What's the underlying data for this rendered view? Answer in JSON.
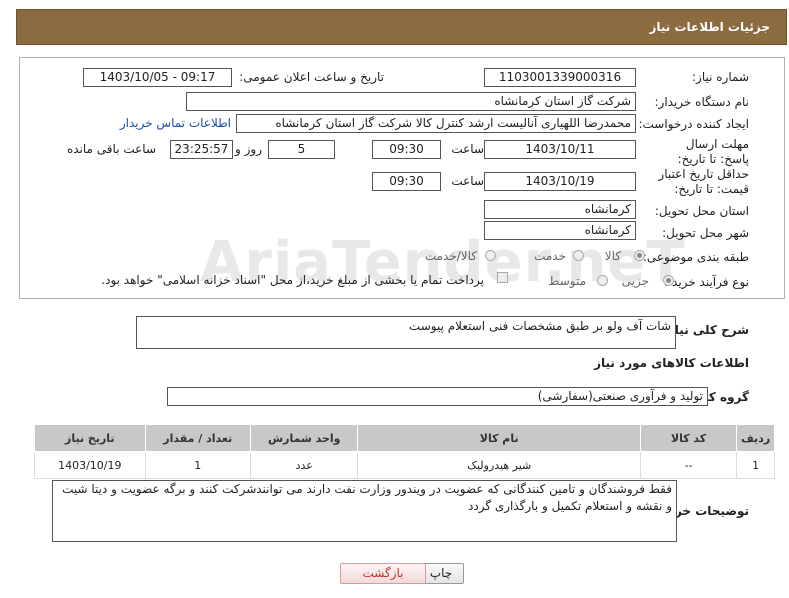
{
  "header": {
    "title": "جزئیات اطلاعات نیاز"
  },
  "fields": {
    "need_number_label": "شماره نیاز:",
    "need_number": "1103001339000316",
    "announce_label": "تاریخ و ساعت اعلان عمومی:",
    "announce_value": "1403/10/05 - 09:17",
    "buyer_org_label": "نام دستگاه خریدار:",
    "buyer_org": "شرکت گاز استان کرمانشاه",
    "creator_label": "ایجاد کننده درخواست:",
    "creator": "محمدرضا اللهیاری آنالیست ارشد کنترل کالا شرکت گاز استان کرمانشاه",
    "contact_link": "اطلاعات تماس خریدار",
    "reply_deadline_label": "مهلت ارسال پاسخ: تا تاریخ:",
    "reply_date": "1403/10/11",
    "time_label": "ساعت",
    "reply_time": "09:30",
    "days_value": "5",
    "days_label": "روز و",
    "remaining_time": "23:25:57",
    "remaining_label": "ساعت باقی مانده",
    "price_validity_label": "حداقل تاریخ اعتبار قیمت: تا تاریخ:",
    "price_date": "1403/10/19",
    "price_time": "09:30",
    "province_label": "استان محل تحویل:",
    "province": "کرمانشاه",
    "city_label": "شهر محل تحویل:",
    "city": "کرمانشاه",
    "category_label": "طبقه بندی موضوعی:",
    "category_options": [
      "کالا",
      "خدمت",
      "کالا/خدمت"
    ],
    "process_label": "نوع فرآیند خرید :",
    "process_options": [
      "جزیی",
      "متوسط"
    ],
    "payment_note": "پرداخت تمام یا بخشی از مبلغ خرید،از محل \"اسناد خزانه اسلامی\" خواهد بود."
  },
  "description": {
    "label": "شرح کلی نیاز:",
    "text": "شات آف ولو بر طبق مشخصات فنی استعلام پیوست"
  },
  "goods": {
    "section_title": "اطلاعات کالاهای مورد نیاز",
    "group_label": "گروه کالا:",
    "group_value": "تولید و فرآوری صنعتی(سفارشی)",
    "columns": [
      "ردیف",
      "کد کالا",
      "نام کالا",
      "واحد شمارش",
      "تعداد / مقدار",
      "تاریخ نیاز"
    ],
    "rows": [
      [
        "1",
        "--",
        "شیر هیدرولیک",
        "عدد",
        "1",
        "1403/10/19"
      ]
    ]
  },
  "buyer_notes": {
    "label": "توضیحات خریدار:",
    "text": "فقط فروشندگان و تامین کنندگانی که عضویت در ویندور وزارت نفت دارند می توانندشرکت کنند  و برگه عضویت و دیتا شیت و نقشه و استعلام تکمیل و بارگذاری گردد"
  },
  "buttons": {
    "print": "چاپ",
    "back": "بازگشت"
  },
  "watermark": "AriaTender.neT",
  "colors": {
    "header_bg": "#8b6b3f",
    "link": "#1b4fa6",
    "back_text": "#c0392b"
  }
}
